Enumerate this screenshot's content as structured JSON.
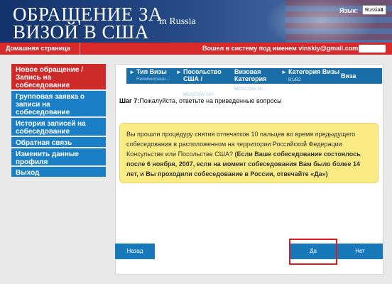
{
  "header": {
    "title_line1": "ОБРАЩЕНИЕ ЗА",
    "title_line2": "ВИЗОЙ В США",
    "country": "in  Russia",
    "language_label": "Язык:",
    "language_selected": "Russian"
  },
  "topbar": {
    "home_link": "Домашняя страница",
    "login_text": "Вошел в систему под именем  vinskiy@gmail.com  ("
  },
  "sidebar": {
    "items": [
      {
        "label": "Новое обращение / Запись на собеседование",
        "active": true
      },
      {
        "label": "Групповая заявка о записи на собеседование"
      },
      {
        "label": "История записей на собеседование"
      },
      {
        "label": "Обратная связь"
      },
      {
        "label": "Изменить данные профиля"
      },
      {
        "label": "Выход"
      }
    ]
  },
  "steps": [
    {
      "label": "Тип Визы",
      "sub": "Неиммиграци..."
    },
    {
      "label": "Посольство США /",
      "sub": "MOSCOW NIV"
    },
    {
      "label": "Визовая Категория",
      "sub": "MOSCOW NI..."
    },
    {
      "label": "Категория Визы",
      "sub": "B1/B2"
    },
    {
      "label": "Виза",
      "sub": ""
    }
  ],
  "step_info": {
    "prefix": "Шаг 7:",
    "text": "Пожалуйста, ответьте на приведенные вопросы"
  },
  "question": {
    "part1": "Вы прошли процедуру снятия отпечатков 10 пальцев во время предыдущего собеседования в расположенном на территории Российской Федерации Консульстве или Посольстве США?",
    "part2": " (Если Ваше собеседование состоялось после 6 ноября, 2007,  если на момент собеседования Вам было более 14 лет, и Вы проходили собеседование в России, отвечайте «Да»)"
  },
  "buttons": {
    "back": "Назад",
    "yes": "Да",
    "no": "Нет"
  },
  "colors": {
    "header_blue": "#244985",
    "topbar_red": "#d82a2a",
    "sidebar_blue": "#1a7fc4",
    "sidebar_active": "#cd2a2a",
    "steps_blue": "#1b6fa8",
    "question_bg": "#fbeb84",
    "button_blue": "#1779ba",
    "highlight": "#e01a1a"
  }
}
